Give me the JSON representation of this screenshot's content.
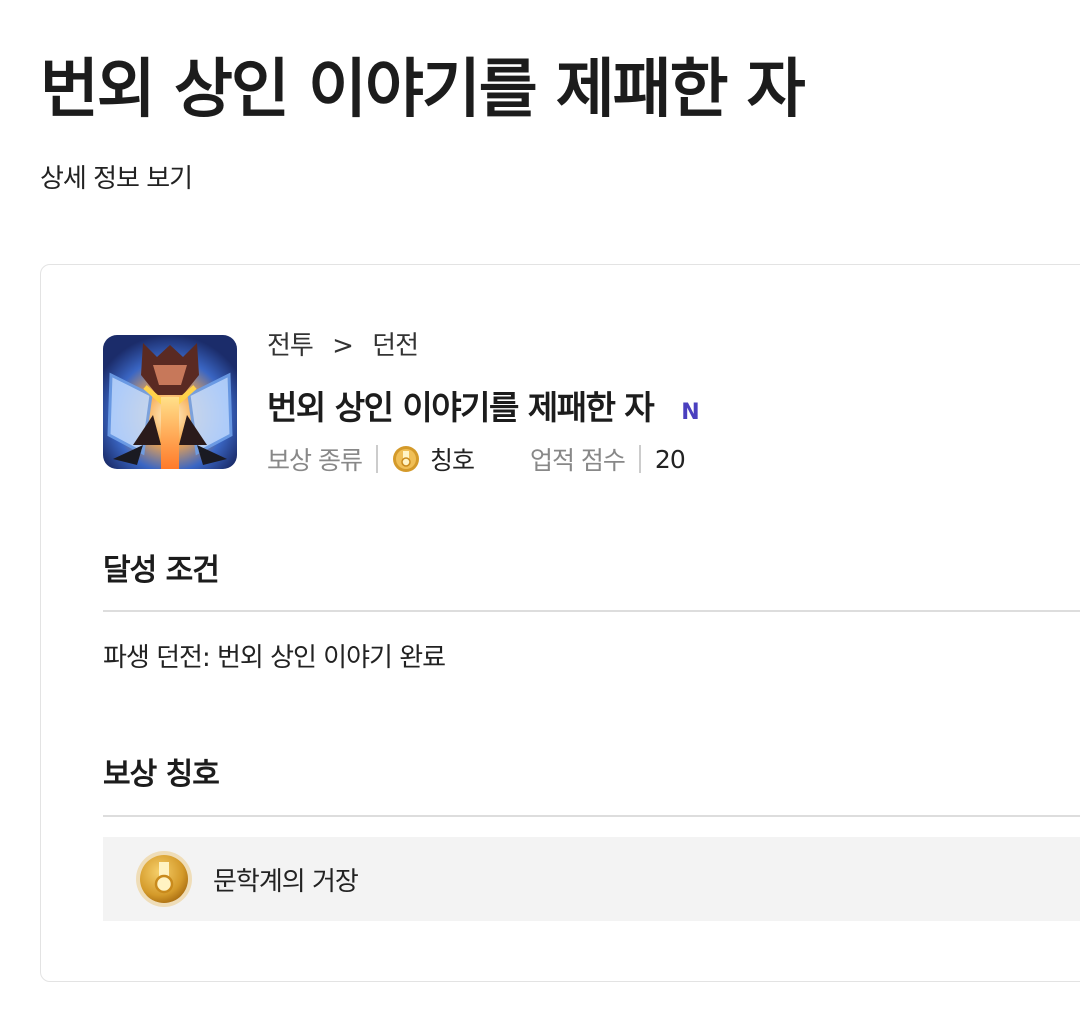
{
  "page": {
    "title": "번외 상인 이야기를 제패한 자",
    "detail_link": "상세 정보 보기"
  },
  "achievement": {
    "breadcrumb": [
      "전투",
      ">",
      "던전"
    ],
    "title": "번외 상인 이야기를 제패한 자",
    "new_badge": "N",
    "reward_type_label": "보상 종류",
    "reward_type_value": "칭호",
    "score_label": "업적 점수",
    "score_value": "20",
    "image_icon": "dungeon-boss-artwork"
  },
  "conditions": {
    "title": "달성 조건",
    "text": "파생 던전: 번외 상인 이야기 완료"
  },
  "reward": {
    "title": "보상 칭호",
    "name": "문학계의 거장",
    "icon": "gold-medal-icon"
  },
  "colors": {
    "badge_new": "#4a3fbf",
    "medal_gold": "#d49a2a",
    "reward_bg": "#f3f3f3"
  }
}
